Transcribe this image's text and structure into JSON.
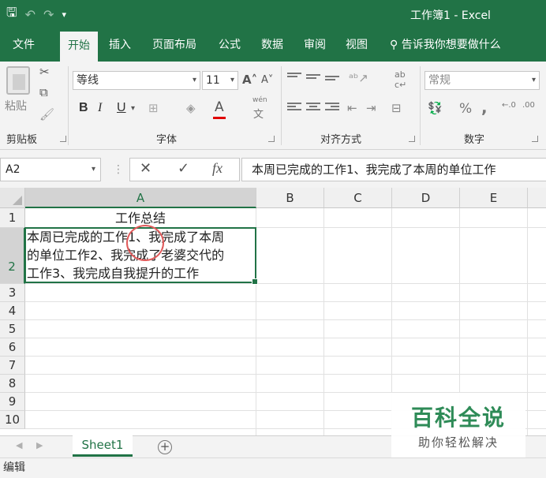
{
  "window": {
    "title": "工作簿1  -  Excel"
  },
  "tabs": [
    {
      "label": "文件"
    },
    {
      "label": "开始"
    },
    {
      "label": "插入"
    },
    {
      "label": "页面布局"
    },
    {
      "label": "公式"
    },
    {
      "label": "数据"
    },
    {
      "label": "审阅"
    },
    {
      "label": "视图"
    }
  ],
  "tell_me": "告诉我你想要做什么",
  "ribbon": {
    "clipboard": {
      "paste_label": "粘贴",
      "group_label": "剪贴板"
    },
    "font": {
      "font_name": "等线",
      "font_size": "11",
      "group_label": "字体",
      "bold": "B",
      "italic": "I",
      "underline": "U",
      "phonetic_top": "wén",
      "phonetic_bottom": "文"
    },
    "alignment": {
      "group_label": "对齐方式"
    },
    "number": {
      "format": "常规",
      "group_label": "数字",
      "percent": "%",
      "comma": ","
    }
  },
  "formula_bar": {
    "name_box": "A2",
    "cancel": "✕",
    "enter": "✓",
    "fx": "fx",
    "content": "本周已完成的工作1、我完成了本周的单位工作"
  },
  "grid": {
    "columns": [
      "A",
      "B",
      "C",
      "D",
      "E"
    ],
    "rows": [
      "1",
      "2",
      "3",
      "4",
      "5",
      "6",
      "7",
      "8",
      "9",
      "10"
    ],
    "cells": {
      "A1": "工作总结",
      "A2_line1": "本周已完成的工作1、我完成了本周",
      "A2_line2": "的单位工作2、我完成了老婆交代的",
      "A2_line3": "工作3、我完成自我提升的工作"
    }
  },
  "sheets": [
    {
      "label": "Sheet1"
    }
  ],
  "status": "编辑",
  "watermark": {
    "title": "百科全说",
    "subtitle": "助你轻松解决"
  },
  "colors": {
    "accent": "#217346",
    "highlight": "#e05a5a"
  }
}
